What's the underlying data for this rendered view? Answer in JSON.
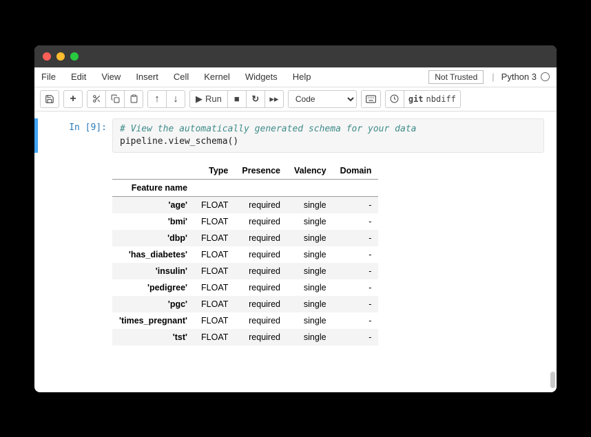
{
  "menubar": {
    "items": [
      "File",
      "Edit",
      "View",
      "Insert",
      "Cell",
      "Kernel",
      "Widgets",
      "Help"
    ],
    "not_trusted": "Not Trusted",
    "kernel_name": "Python 3"
  },
  "toolbar": {
    "run_label": "Run",
    "cell_type_selected": "Code",
    "git_label": "git",
    "nbdiff_label": "nbdiff"
  },
  "cell": {
    "prompt": "In [9]:",
    "code_comment": "# View the automatically generated schema for your data",
    "code_line": "pipeline.view_schema()"
  },
  "schema": {
    "columns": [
      "Type",
      "Presence",
      "Valency",
      "Domain"
    ],
    "row_header_label": "Feature name",
    "rows": [
      {
        "feature": "'age'",
        "type": "FLOAT",
        "presence": "required",
        "valency": "single",
        "domain": "-"
      },
      {
        "feature": "'bmi'",
        "type": "FLOAT",
        "presence": "required",
        "valency": "single",
        "domain": "-"
      },
      {
        "feature": "'dbp'",
        "type": "FLOAT",
        "presence": "required",
        "valency": "single",
        "domain": "-"
      },
      {
        "feature": "'has_diabetes'",
        "type": "FLOAT",
        "presence": "required",
        "valency": "single",
        "domain": "-"
      },
      {
        "feature": "'insulin'",
        "type": "FLOAT",
        "presence": "required",
        "valency": "single",
        "domain": "-"
      },
      {
        "feature": "'pedigree'",
        "type": "FLOAT",
        "presence": "required",
        "valency": "single",
        "domain": "-"
      },
      {
        "feature": "'pgc'",
        "type": "FLOAT",
        "presence": "required",
        "valency": "single",
        "domain": "-"
      },
      {
        "feature": "'times_pregnant'",
        "type": "FLOAT",
        "presence": "required",
        "valency": "single",
        "domain": "-"
      },
      {
        "feature": "'tst'",
        "type": "FLOAT",
        "presence": "required",
        "valency": "single",
        "domain": "-"
      }
    ]
  }
}
